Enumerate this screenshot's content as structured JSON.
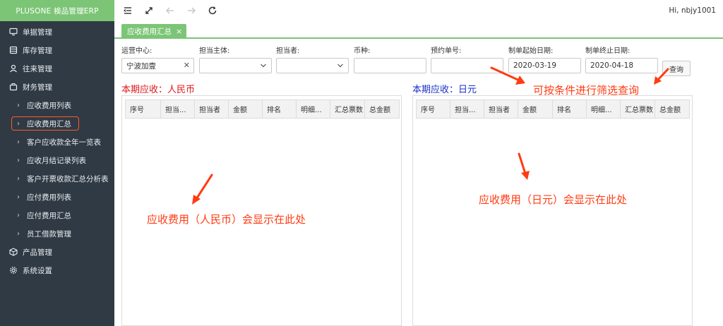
{
  "brand": "PLUSONE 検品管理ERP",
  "sidebar": {
    "items": [
      {
        "label": "单据管理",
        "icon": "monitor-icon"
      },
      {
        "label": "库存管理",
        "icon": "database-icon"
      },
      {
        "label": "往来管理",
        "icon": "user-icon"
      },
      {
        "label": "财务管理",
        "icon": "briefcase-icon"
      },
      {
        "label": "产品管理",
        "icon": "cube-icon"
      },
      {
        "label": "系统设置",
        "icon": "gear-icon"
      }
    ],
    "finance_sub": [
      "应收费用列表",
      "应收费用汇总",
      "客户应收款全年一览表",
      "应收月结记录列表",
      "客户开票收款汇总分析表",
      "应付费用列表",
      "应付费用汇总",
      "员工借款管理"
    ]
  },
  "topbar": {
    "greeting": "Hi, nbjy1001"
  },
  "tab": {
    "label": "应收费用汇总"
  },
  "filters": {
    "center_label": "运营中心:",
    "center_value": "宁波加壹",
    "entity_label": "担当主体:",
    "person_label": "担当者:",
    "currency_label": "币种:",
    "booking_label": "预约单号:",
    "start_label": "制单起始日期:",
    "start_value": "2020-03-19",
    "end_label": "制单终止日期:",
    "end_value": "2020-04-18",
    "query_label": "查询"
  },
  "sections": {
    "rmb_title": "本期应收：人民币",
    "jpy_title": "本期应收：日元"
  },
  "table": {
    "columns": [
      "序号",
      "担当...",
      "担当者",
      "金额",
      "排名",
      "明细...",
      "汇总票数",
      "总金额"
    ]
  },
  "annotations": {
    "filter_note": "可按条件进行筛选查询",
    "rmb_note": "应收费用（人民币）会显示在此处",
    "jpy_note": "应收费用（日元）会显示在此处"
  },
  "colors": {
    "brand": "#7cc576",
    "sidebar": "#2f3a44",
    "annotation": "#ff3b12",
    "rmb_title": "#e0161a",
    "jpy_title": "#1a2fc9"
  }
}
